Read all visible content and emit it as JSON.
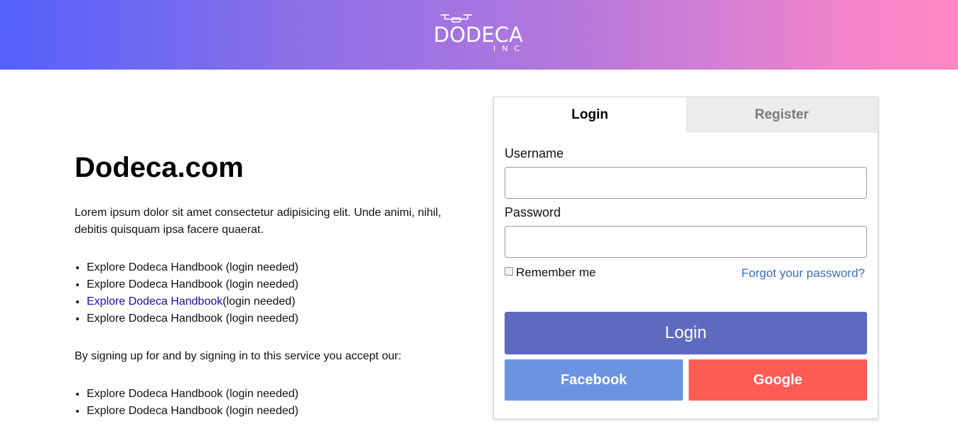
{
  "header": {
    "brand_name": "DODECA",
    "brand_sub": "INC",
    "gradient_start": "#5361fb",
    "gradient_end": "#ff86c4"
  },
  "intro": {
    "title": "Dodeca.com",
    "description": "Lorem ipsum dolor sit amet consectetur adipisicing elit. Unde animi, nihil, debitis quisquam ipsa facere quaerat.",
    "list1": [
      {
        "text": "Explore Dodeca Handbook (login needed)",
        "link": false
      },
      {
        "text": "Explore Dodeca Handbook (login needed)",
        "link": false
      },
      {
        "link_text": "Explore Dodeca Handbook",
        "suffix": "(login needed)",
        "link": true
      },
      {
        "text": "Explore Dodeca Handbook (login needed)",
        "link": false
      }
    ],
    "accept_text": "By signing up for and by signing in to this service you accept our:",
    "list2": [
      {
        "text": "Explore Dodeca Handbook (login needed)"
      },
      {
        "text": "Explore Dodeca Handbook (login needed)"
      }
    ]
  },
  "auth": {
    "tabs": [
      {
        "label": "Login",
        "active": true
      },
      {
        "label": "Register",
        "active": false
      }
    ],
    "username_label": "Username",
    "username_value": "",
    "password_label": "Password",
    "password_value": "",
    "remember_label": "Remember me",
    "remember_checked": false,
    "forgot_label": "Forgot your password?",
    "login_button": "Login",
    "facebook_button": "Facebook",
    "google_button": "Google",
    "colors": {
      "login_button": "#5e6abf",
      "facebook": "#6a94e0",
      "google": "#ff5c55",
      "link": "#3d6cc9"
    }
  }
}
